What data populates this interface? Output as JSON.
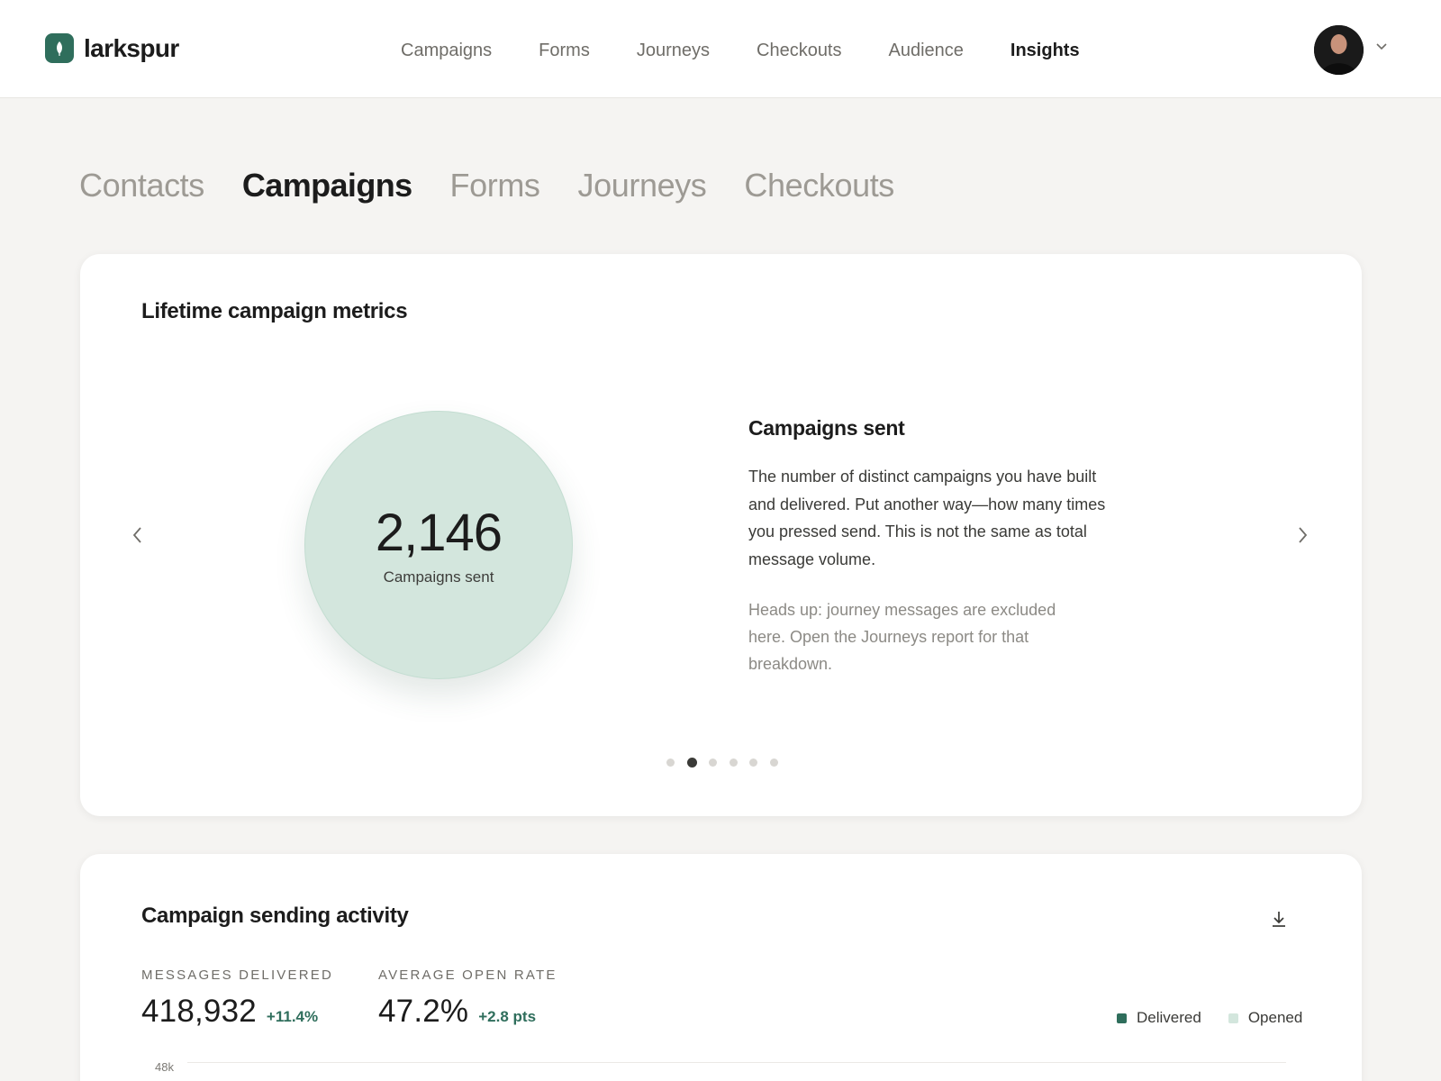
{
  "app": {
    "name": "larkspur"
  },
  "nav": {
    "items": [
      {
        "label": "Campaigns"
      },
      {
        "label": "Forms"
      },
      {
        "label": "Journeys"
      },
      {
        "label": "Checkouts"
      },
      {
        "label": "Audience"
      },
      {
        "label": "Insights",
        "active": true
      }
    ]
  },
  "subtabs": [
    {
      "label": "Contacts"
    },
    {
      "label": "Campaigns",
      "active": true
    },
    {
      "label": "Forms"
    },
    {
      "label": "Journeys"
    },
    {
      "label": "Checkouts"
    }
  ],
  "metrics_card": {
    "title": "Lifetime campaign metrics",
    "bubble_value": "2,146",
    "bubble_label": "Campaigns sent",
    "heading": "Campaigns sent",
    "description": "The number of distinct campaigns you have built and delivered. Put another way—how many times you pressed send. This is not the same as total message volume.",
    "note": "Heads up: journey messages are excluded here. Open the Journeys report for that breakdown.",
    "carousel": {
      "total_slides": 6,
      "active_slide": 2
    }
  },
  "activity_card": {
    "title": "Campaign sending activity",
    "stats": [
      {
        "label": "MESSAGES DELIVERED",
        "value": "418,932",
        "delta": "+11.4%"
      },
      {
        "label": "AVERAGE OPEN RATE",
        "value": "47.2%",
        "delta": "+2.8 pts"
      }
    ],
    "legend": [
      {
        "label": "Delivered",
        "color": "#2f6e5c"
      },
      {
        "label": "Opened",
        "color": "#d3e6dd"
      }
    ],
    "y_axis_top_label": "48k"
  },
  "colors": {
    "accent": "#2f6e5c",
    "bubble": "#d3e6dd",
    "background": "#f5f4f2"
  },
  "icons": {
    "brand": "leaf-icon",
    "avatar_menu": "chevron-down-icon",
    "prev": "chevron-left-icon",
    "next": "chevron-right-icon",
    "download": "download-icon"
  }
}
